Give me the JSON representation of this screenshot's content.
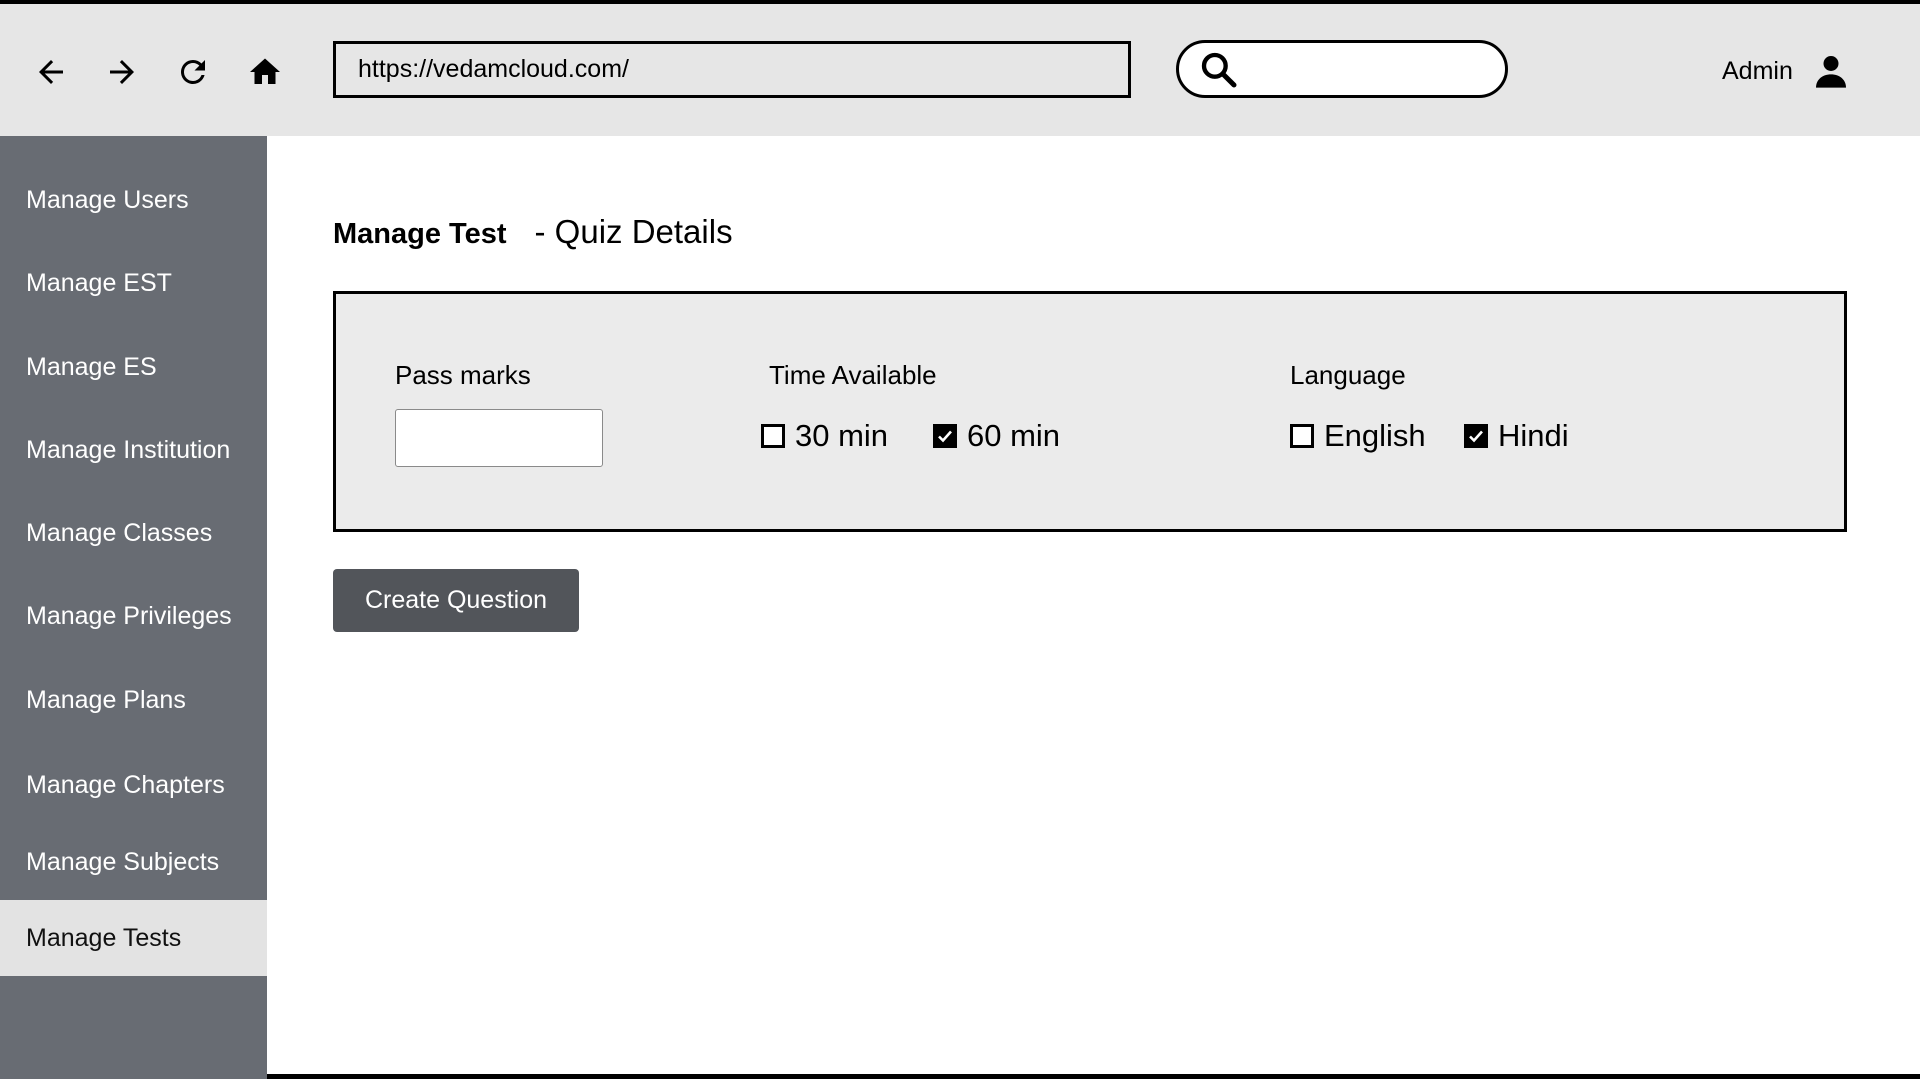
{
  "browser": {
    "url": "https://vedamcloud.com/",
    "search_value": "",
    "user_label": "Admin",
    "icons": [
      "back-arrow-icon",
      "forward-arrow-icon",
      "reload-icon",
      "home-icon",
      "search-icon",
      "user-icon"
    ]
  },
  "sidebar": {
    "items": [
      {
        "label": "Manage Users"
      },
      {
        "label": "Manage EST"
      },
      {
        "label": "Manage ES"
      },
      {
        "label": "Manage Institution"
      },
      {
        "label": "Manage Classes"
      },
      {
        "label": "Manage Privileges"
      },
      {
        "label": "Manage Plans"
      },
      {
        "label": "Manage Chapters"
      },
      {
        "label": "Manage Subjects"
      },
      {
        "label": "Manage Tests"
      }
    ],
    "active_item": "Manage Tests"
  },
  "main": {
    "title": "Manage Test",
    "subtitle": "- Quiz Details",
    "pass_marks": {
      "label": "Pass marks",
      "value": ""
    },
    "time_available": {
      "label": "Time Available",
      "options": [
        {
          "label": "30 min",
          "checked": false
        },
        {
          "label": "60 min",
          "checked": true
        }
      ]
    },
    "language": {
      "label": "Language",
      "options": [
        {
          "label": "English",
          "checked": false
        },
        {
          "label": "Hindi",
          "checked": true
        }
      ]
    },
    "create_button_label": "Create Question"
  },
  "colors": {
    "sidebar_bg": "#686c73",
    "sidebar_active_bg": "#e3e3e3",
    "browser_bar_bg": "#e6e6e6",
    "panel_bg": "#ebebeb",
    "button_bg": "#52555a"
  }
}
